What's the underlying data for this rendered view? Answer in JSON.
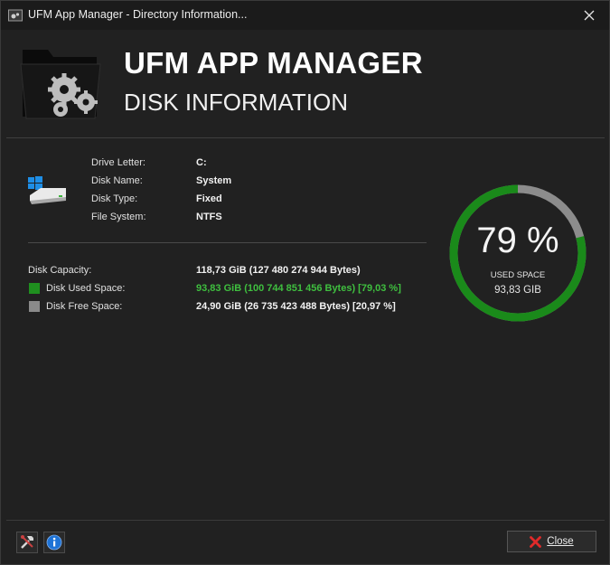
{
  "window": {
    "title": "UFM App Manager - Directory Information..."
  },
  "header": {
    "title": "UFM APP MANAGER",
    "subtitle": "DISK INFORMATION"
  },
  "drive": {
    "letter": {
      "label": "Drive Letter:",
      "value": "C:"
    },
    "name": {
      "label": "Disk Name:",
      "value": "System"
    },
    "type": {
      "label": "Disk Type:",
      "value": "Fixed"
    },
    "filesystem": {
      "label": "File System:",
      "value": "NTFS"
    }
  },
  "capacity": {
    "total": {
      "label": "Disk Capacity:",
      "value": "118,73 GiB (127 480 274 944 Bytes)"
    },
    "used": {
      "label": "Disk Used Space:",
      "value": "93,83 GiB (100 744 851 456 Bytes) [79,03 %]",
      "color": "#1f8f1f"
    },
    "free": {
      "label": "Disk Free Space:",
      "value": "24,90 GiB (26 735 423 488 Bytes) [20,97 %]",
      "color": "#8a8a8a"
    }
  },
  "gauge": {
    "percent_text": "79 %",
    "fraction_used": 0.7903,
    "label": "USED SPACE",
    "sub": "93,83 GIB",
    "used_color": "#1a8a1a",
    "free_color": "#8c8c8c"
  },
  "footer": {
    "close_label": "Close"
  },
  "icons": {
    "app": "ufm-app-icon",
    "window_close": "close-icon",
    "folder": "folder-gears-icon",
    "drive": "windows-drive-icon",
    "tools": "tools-icon",
    "info": "info-icon",
    "close_button": "red-x-icon"
  },
  "colors": {
    "value_used": "#3fbf3f",
    "accent_info": "#1e73d6"
  }
}
